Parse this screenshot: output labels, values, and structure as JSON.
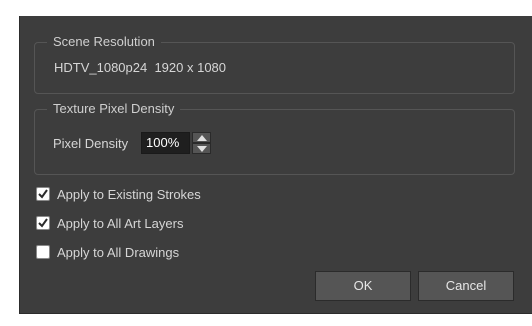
{
  "scene_resolution": {
    "title": "Scene Resolution",
    "value": "HDTV_1080p24  1920 x 1080"
  },
  "texture_pixel_density": {
    "title": "Texture Pixel Density",
    "label": "Pixel Density",
    "value": "100%"
  },
  "options": [
    {
      "label": "Apply to Existing Strokes",
      "checked": true
    },
    {
      "label": "Apply to All Art Layers",
      "checked": true
    },
    {
      "label": "Apply to All Drawings",
      "checked": false
    }
  ],
  "buttons": {
    "ok": "OK",
    "cancel": "Cancel"
  },
  "icons": {
    "spin_up": "triangle-up-icon",
    "spin_down": "triangle-down-icon",
    "check": "checkmark-icon"
  },
  "colors": {
    "dialog_bg": "#3d3d3d",
    "text": "#d6d6d6"
  }
}
